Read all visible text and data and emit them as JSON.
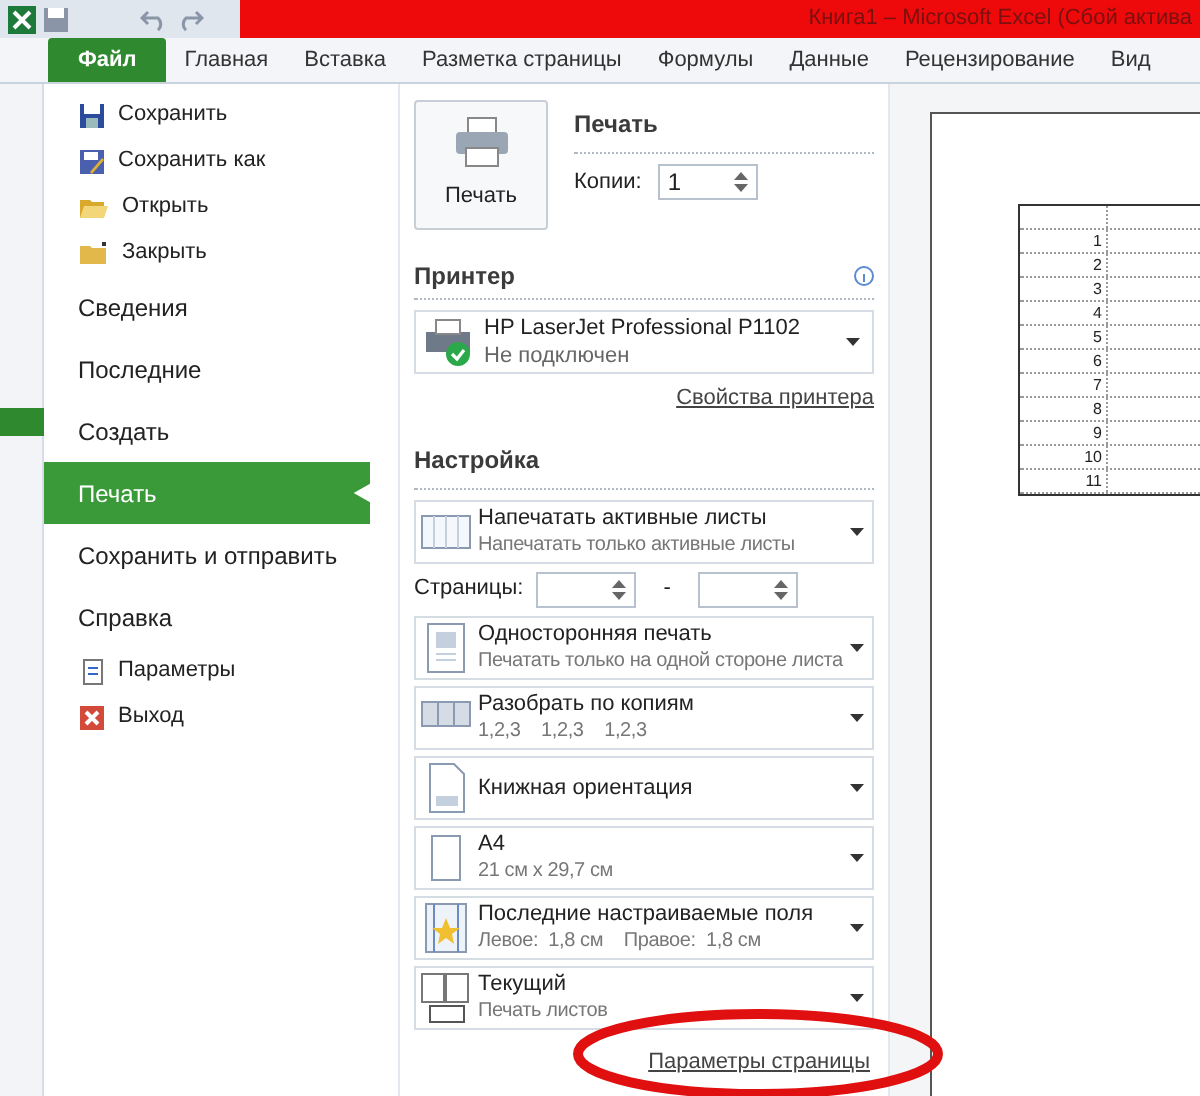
{
  "window": {
    "title": "Книга1 – Microsoft Excel (Сбой актива"
  },
  "tabs": [
    {
      "label": "Файл",
      "selected": true
    },
    {
      "label": "Главная",
      "selected": false
    },
    {
      "label": "Вставка",
      "selected": false
    },
    {
      "label": "Разметка страницы",
      "selected": false
    },
    {
      "label": "Формулы",
      "selected": false
    },
    {
      "label": "Данные",
      "selected": false
    },
    {
      "label": "Рецензирование",
      "selected": false
    },
    {
      "label": "Вид",
      "selected": false
    }
  ],
  "sidebar": {
    "items": [
      {
        "kind": "save",
        "label": "Сохранить",
        "selected": false
      },
      {
        "kind": "saveas",
        "label": "Сохранить как",
        "selected": false
      },
      {
        "kind": "open",
        "label": "Открыть",
        "selected": false
      },
      {
        "kind": "close",
        "label": "Закрыть",
        "selected": false
      },
      {
        "kind": "section",
        "label": "Сведения",
        "selected": false
      },
      {
        "kind": "section",
        "label": "Последние",
        "selected": false
      },
      {
        "kind": "section",
        "label": "Создать",
        "selected": false
      },
      {
        "kind": "section",
        "label": "Печать",
        "selected": true
      },
      {
        "kind": "section",
        "label": "Сохранить и отправить",
        "selected": false
      },
      {
        "kind": "section",
        "label": "Справка",
        "selected": false
      },
      {
        "kind": "options",
        "label": "Параметры",
        "selected": false
      },
      {
        "kind": "exit",
        "label": "Выход",
        "selected": false
      }
    ]
  },
  "print": {
    "button": "Печать",
    "heading": "Печать",
    "copies_label": "Копии:",
    "copies": "1"
  },
  "printer": {
    "heading": "Принтер",
    "name": "HP LaserJet Professional P1102",
    "status": "Не подключен",
    "properties_link": "Свойства принтера"
  },
  "settings": {
    "heading": "Настройка",
    "pages_label": "Страницы:",
    "pages_separator": "-",
    "options": [
      {
        "kind": "sheets",
        "title": "Напечатать активные листы",
        "subtitle": "Напечатать только активные листы"
      },
      {
        "kind": "sides",
        "title": "Односторонняя печать",
        "subtitle": "Печатать только на одной стороне листа"
      },
      {
        "kind": "collate",
        "title": "Разобрать по копиям",
        "subtitle": "1,2,3    1,2,3    1,2,3"
      },
      {
        "kind": "orientation",
        "title": "Книжная ориентация"
      },
      {
        "kind": "size",
        "title": "A4",
        "subtitle": "21 см x 29,7 см"
      },
      {
        "kind": "margins",
        "title": "Последние настраиваемые поля",
        "subtitle": "Левое:  1,8 см    Правое:  1,8 см"
      },
      {
        "kind": "scaling",
        "title": "Текущий",
        "subtitle": "Печать листов"
      }
    ],
    "page_setup_link": "Параметры страницы"
  },
  "preview": {
    "row_numbers": [
      "1",
      "2",
      "3",
      "4",
      "5",
      "6",
      "7",
      "8",
      "9",
      "10",
      "11"
    ]
  }
}
